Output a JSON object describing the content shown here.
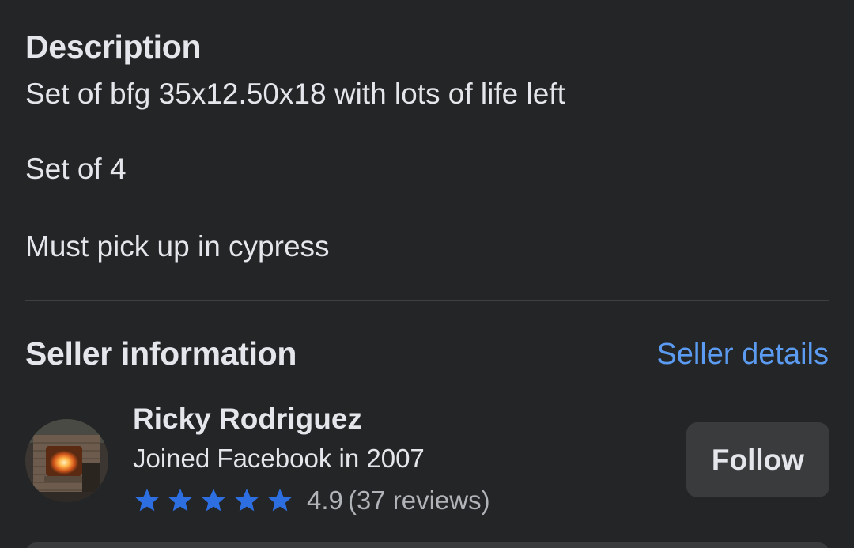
{
  "description": {
    "title": "Description",
    "lines": [
      "Set of bfg 35x12.50x18 with lots of life left",
      "Set of 4",
      "Must pick up in cypress"
    ]
  },
  "seller": {
    "section_title": "Seller information",
    "details_link": "Seller details",
    "name": "Ricky Rodriguez",
    "joined": "Joined Facebook in 2007",
    "rating_score": "4.9",
    "rating_count": "(37 reviews)",
    "rating_stars": 5,
    "follow_label": "Follow"
  },
  "icons": {
    "star": "star-icon",
    "avatar": "seller-avatar-image"
  },
  "colors": {
    "background": "#242526",
    "text_primary": "#e4e6eb",
    "text_secondary": "#b0b3b8",
    "link": "#5b9cf2",
    "star": "#2d6ee0",
    "button_bg": "#3a3b3c"
  }
}
